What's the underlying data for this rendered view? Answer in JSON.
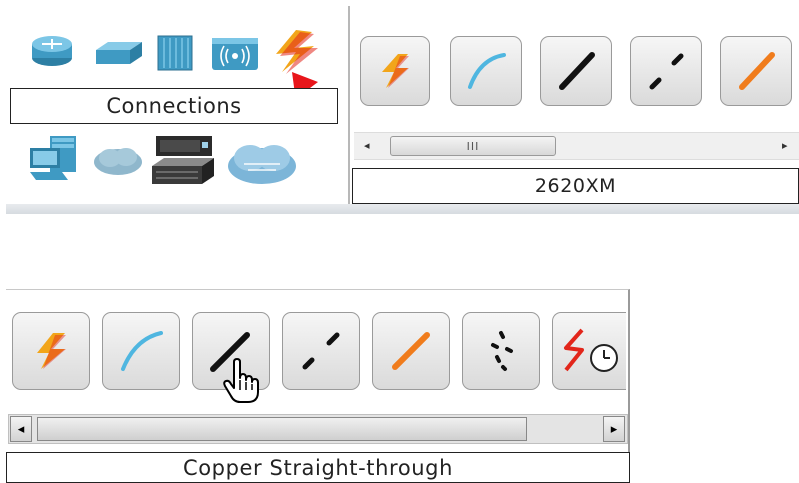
{
  "device_palette": {
    "icons": [
      "router-icon",
      "switch-icon",
      "hub-icon",
      "wireless-device-icon",
      "connections-lightning-icon"
    ],
    "lower_icons": [
      "end-device-pc-icon",
      "wan-emulation-cloud-icon",
      "custom-device-icon",
      "multiuser-cloud-icon"
    ],
    "category_label": "Connections"
  },
  "cable_palette_top": {
    "buttons": [
      "automatic-cable-icon",
      "console-cable-icon",
      "copper-straight-through-icon",
      "copper-cross-over-icon",
      "fiber-cable-icon"
    ],
    "scrollbar": {
      "left_arrow": "◂",
      "right_arrow": "▸",
      "thumb_grip": "III"
    },
    "selected_device_label": "2620XM"
  },
  "cable_palette_bottom": {
    "buttons": [
      "automatic-cable-icon",
      "console-cable-icon",
      "copper-straight-through-icon",
      "copper-cross-over-icon",
      "fiber-cable-icon",
      "phone-cable-icon",
      "serial-dce-clock-icon"
    ],
    "scrollbar": {
      "left_arrow": "◂",
      "right_arrow": "▸"
    },
    "hover_label": "Copper Straight-through"
  },
  "colors": {
    "lightning": "#f2a51a",
    "lightning_red": "#e2261b",
    "console_cable": "#4fb6e0",
    "fiber": "#f07c1c",
    "pointer_arrow": "#e8161b",
    "serial_red": "#e2261b"
  }
}
